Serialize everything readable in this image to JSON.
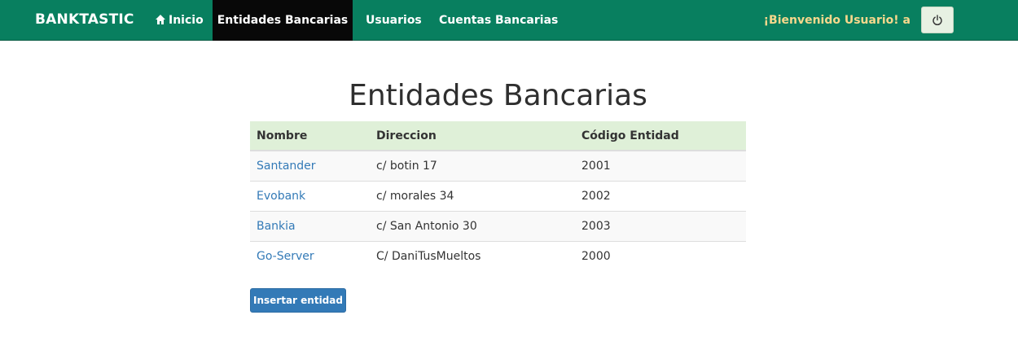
{
  "navbar": {
    "brand": "BANKTASTIC",
    "home_label": "Inicio",
    "items": [
      {
        "label": "Entidades Bancarias",
        "active": true
      },
      {
        "label": "Usuarios",
        "active": false
      },
      {
        "label": "Cuentas Bancarias",
        "active": false
      }
    ],
    "welcome": "¡Bienvenido Usuario! a",
    "logout_icon": "power-icon"
  },
  "main": {
    "title": "Entidades Bancarias",
    "table": {
      "headers": [
        "Nombre",
        "Direccion",
        "Código Entidad"
      ],
      "rows": [
        {
          "nombre": "Santander",
          "direccion": "c/ botin 17",
          "codigo": "2001"
        },
        {
          "nombre": "Evobank",
          "direccion": "c/ morales 34",
          "codigo": "2002"
        },
        {
          "nombre": "Bankia",
          "direccion": "c/ San Antonio 30",
          "codigo": "2003"
        },
        {
          "nombre": "Go-Server",
          "direccion": "C/ DaniTusMueltos",
          "codigo": "2000"
        }
      ]
    },
    "insert_button": "Insertar entidad"
  },
  "colors": {
    "navbar": "#087f5f",
    "active_tab": "#080808",
    "welcome": "#f7d88c",
    "header_row": "#dff0d8",
    "link": "#337ab7"
  }
}
